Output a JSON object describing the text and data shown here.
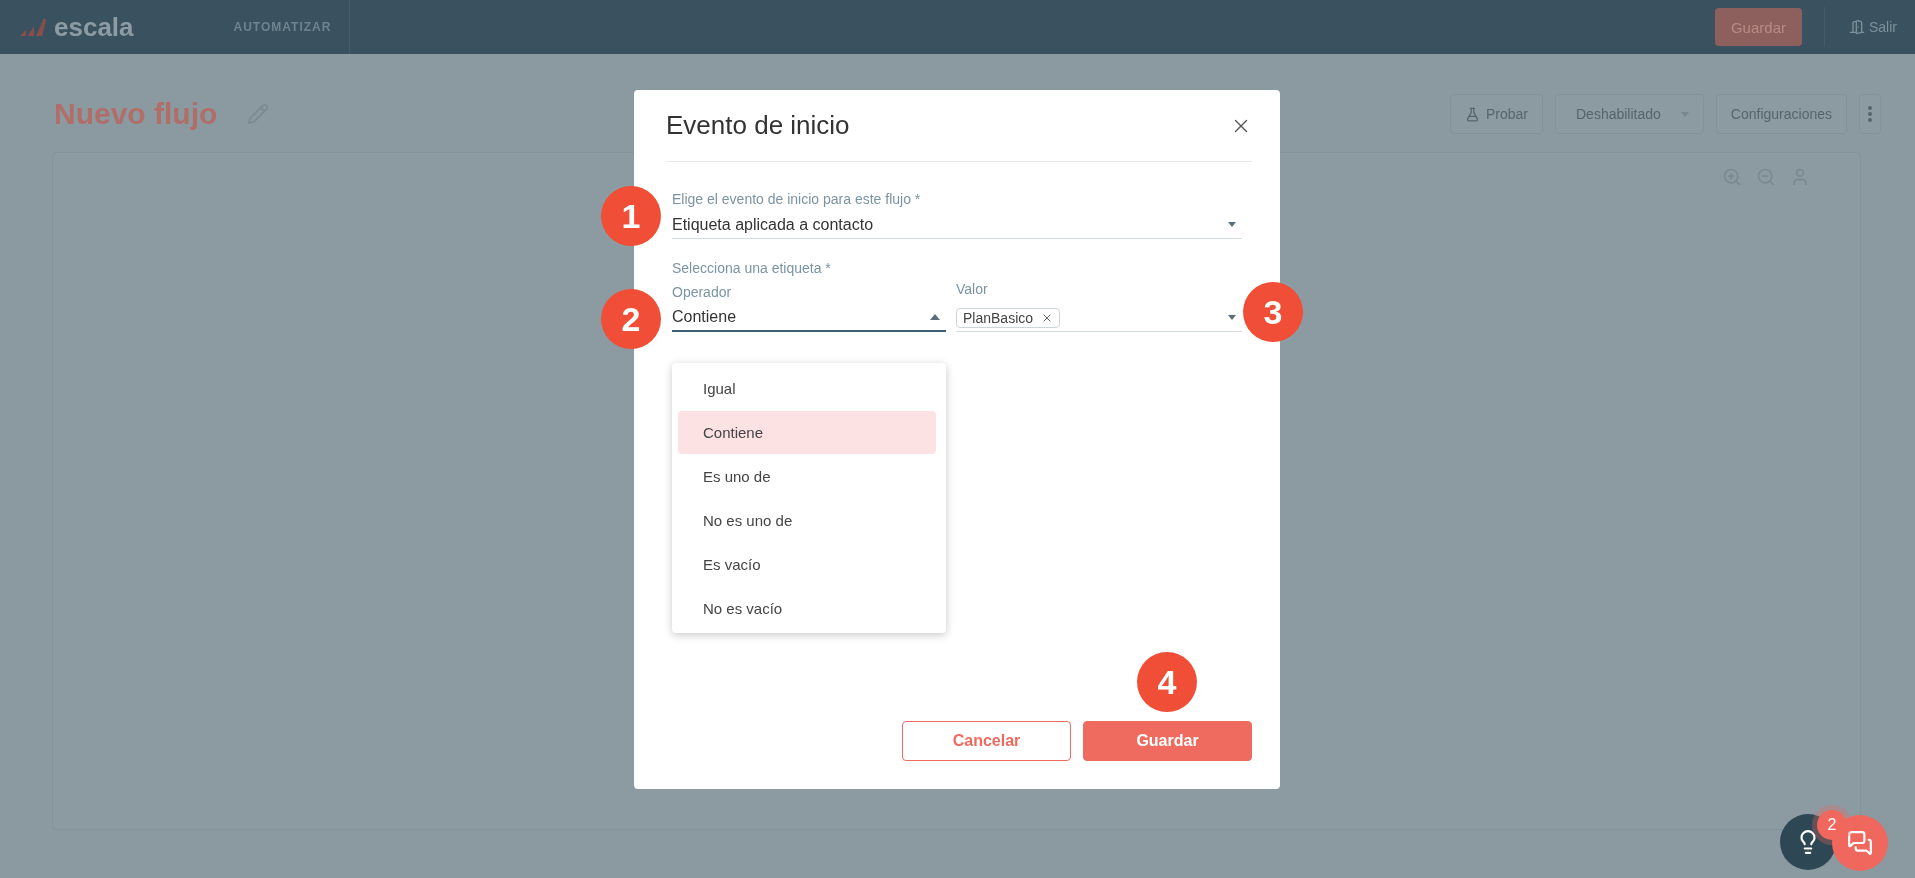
{
  "top_bar": {
    "logo": "escala",
    "section": "AUTOMATIZAR",
    "save_button": "Guardar",
    "exit_button": "Salir"
  },
  "header": {
    "title": "Nuevo flujo",
    "actions": [
      {
        "kind": "test",
        "label": "Probar"
      },
      {
        "kind": "dropdown",
        "label": "Deshabilitado"
      },
      {
        "kind": "button",
        "label": "Configuraciones"
      },
      {
        "kind": "menu"
      }
    ]
  },
  "dialog": {
    "title": "Evento de inicio",
    "start_event": {
      "label": "Elige el evento de inicio para este flujo *",
      "value": "Etiqueta aplicada a contacto"
    },
    "tag_section": "Selecciona una etiqueta *",
    "operator": {
      "label": "Operador",
      "value": "Contiene",
      "expanded": true,
      "options": [
        {
          "label": "Igual",
          "selected": false
        },
        {
          "label": "Contiene",
          "selected": true
        },
        {
          "label": "Es uno de",
          "selected": false
        },
        {
          "label": "No es uno de",
          "selected": false
        },
        {
          "label": "Es vacío",
          "selected": false
        },
        {
          "label": "No es vacío",
          "selected": false
        }
      ]
    },
    "value_field": {
      "label": "Valor",
      "chips": [
        "PlanBasico"
      ]
    },
    "buttons": {
      "cancel": "Cancelar",
      "save": "Guardar"
    }
  },
  "callouts": [
    "1",
    "2",
    "3",
    "4"
  ],
  "help_widget": {
    "badge": "2"
  }
}
